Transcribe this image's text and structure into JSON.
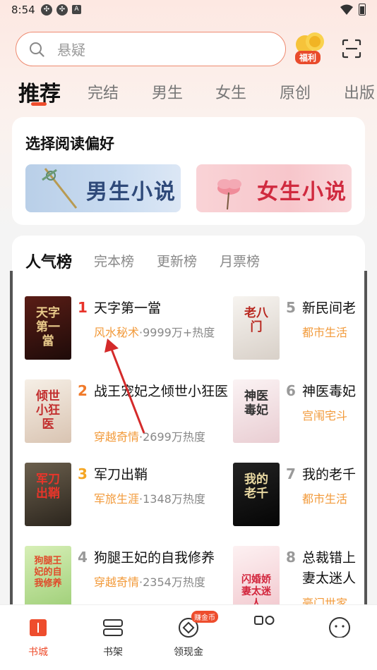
{
  "status": {
    "time": "8:54"
  },
  "search": {
    "placeholder": "悬疑"
  },
  "welfare": {
    "label": "福利"
  },
  "categories": [
    "推荐",
    "完结",
    "男生",
    "女生",
    "原创",
    "出版"
  ],
  "preference": {
    "title": "选择阅读偏好",
    "male_label": "男生小说",
    "female_label": "女生小说"
  },
  "rank_tabs": [
    "人气榜",
    "完本榜",
    "更新榜",
    "月票榜"
  ],
  "books_left": [
    {
      "rank": "1",
      "title": "天字第一當",
      "genre": "风水秘术",
      "heat": "·9999万+热度",
      "cover_text": "天字第一當",
      "cover_color": "#3a1512"
    },
    {
      "rank": "2",
      "title": "战王宠妃之倾世小狂医",
      "genre": "穿越奇情",
      "heat": "·2699万热度",
      "cover_text": "倾世小狂医",
      "cover_color": "#f3ece4"
    },
    {
      "rank": "3",
      "title": "军刀出鞘",
      "genre": "军旅生涯",
      "heat": "·1348万热度",
      "cover_text": "军刀出鞘",
      "cover_color": "#4a4236"
    },
    {
      "rank": "4",
      "title": "狗腿王妃的自我修养",
      "genre": "穿越奇情",
      "heat": "·2354万热度",
      "cover_text": "狗腿王妃的自我修养",
      "cover_color": "#c9e6a8"
    }
  ],
  "books_right": [
    {
      "rank": "5",
      "title": "新民间老",
      "genre": "都市生活",
      "cover_text": "老八门",
      "cover_color": "#f2eeea"
    },
    {
      "rank": "6",
      "title": "神医毒妃",
      "genre": "宫闱宅斗",
      "cover_text": "神医毒妃",
      "cover_color": "#f6eef0"
    },
    {
      "rank": "7",
      "title": "我的老千",
      "genre": "都市生活",
      "cover_text": "我的老千",
      "cover_color": "#141414"
    },
    {
      "rank": "8",
      "title": "总裁错上妻太迷人",
      "genre": "豪门世家",
      "cover_text": "闪婚娇妻太迷人",
      "cover_color": "#f9e8ea"
    }
  ],
  "nav": [
    {
      "label": "书城",
      "icon": "book-city-icon"
    },
    {
      "label": "书架",
      "icon": "bookshelf-icon"
    },
    {
      "label": "领现金",
      "icon": "coin-icon",
      "badge": "赚金币"
    },
    {
      "label": "",
      "icon": "apps-icon"
    },
    {
      "label": "",
      "icon": "profile-icon"
    }
  ]
}
